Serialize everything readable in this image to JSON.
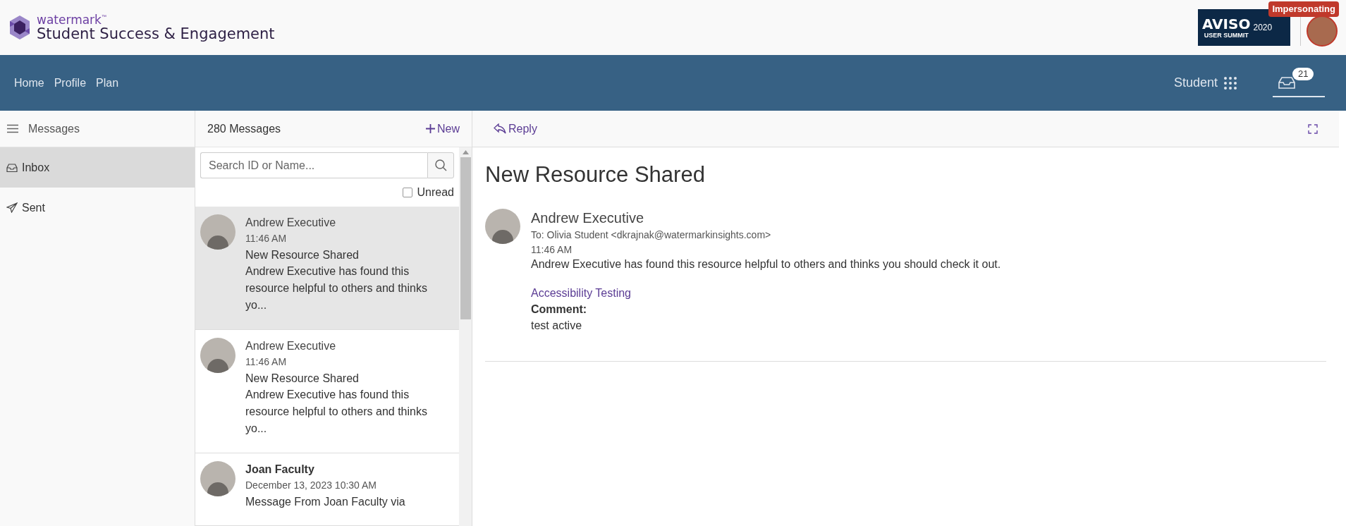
{
  "header": {
    "brand_small": "watermark",
    "trademark": "™",
    "brand_title": "Student Success & Engagement",
    "banner": {
      "title": "AVISO",
      "year": "2020",
      "subtitle": "USER SUMMIT"
    },
    "impersonating_badge": "Impersonating"
  },
  "nav": {
    "links": [
      {
        "label": "Home"
      },
      {
        "label": "Profile"
      },
      {
        "label": "Plan"
      }
    ],
    "role": "Student",
    "inbox_count": "21"
  },
  "sidebar": {
    "title": "Messages",
    "items": [
      {
        "label": "Inbox",
        "kind": "inbox",
        "selected": true
      },
      {
        "label": "Sent",
        "kind": "sent",
        "selected": false
      }
    ]
  },
  "message_list": {
    "count": "280 Messages",
    "new_button": "New",
    "search": {
      "placeholder": "Search ID or Name..."
    },
    "unread_filter": {
      "label": "Unread",
      "checked": false
    },
    "messages": [
      {
        "sender": "Andrew Executive",
        "time": "11:46 AM",
        "subject": "New Resource Shared",
        "preview": "Andrew Executive has found this resource helpful to others and thinks yo...",
        "selected": true,
        "unread": false
      },
      {
        "sender": "Andrew Executive",
        "time": "11:46 AM",
        "subject": "New Resource Shared",
        "preview": "Andrew Executive has found this resource helpful to others and thinks yo...",
        "selected": false,
        "unread": false
      },
      {
        "sender": "Joan Faculty",
        "time": "December 13, 2023 10:30 AM",
        "subject": "Message From Joan Faculty via",
        "selected": false,
        "unread": true
      }
    ]
  },
  "message_detail": {
    "reply_button": "Reply",
    "subject": "New Resource Shared",
    "sender": "Andrew Executive",
    "to": "To: Olivia Student <dkrajnak@watermarkinsights.com>",
    "time": "11:46 AM",
    "body": "Andrew Executive has found this resource helpful to others and thinks you should check it out.",
    "resource_link": "Accessibility Testing",
    "comment_label": "Comment:",
    "comment": "test active"
  }
}
